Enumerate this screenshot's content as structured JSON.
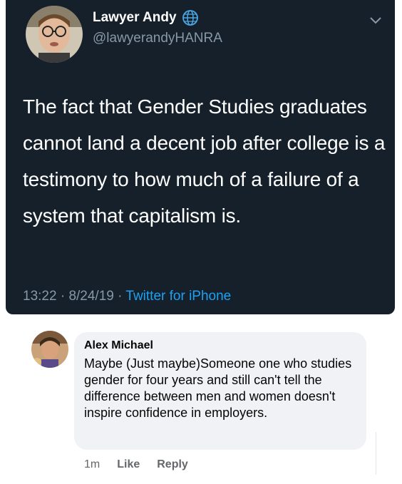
{
  "tweet": {
    "author_name": "Lawyer Andy",
    "handle": "@lawyerandyHANRA",
    "text": "The fact that Gender Studies graduates cannot land a decent job after college is a testimony to how much of a failure of a system that capitalism is.",
    "time": "13:22",
    "date": "8/24/19",
    "source": "Twitter for iPhone",
    "sep": "·",
    "colors": {
      "background": "#15202b",
      "secondary_text": "#8899a6",
      "link": "#1da1f2"
    }
  },
  "comment": {
    "author_name": "Alex Michael",
    "text": "Maybe (Just maybe)Someone one who studies gender for four years and still can't tell the difference between men and women doesn't inspire confidence in employers.",
    "time": "1m",
    "like_label": "Like",
    "reply_label": "Reply",
    "colors": {
      "bubble": "#f0f2f5",
      "muted": "#65676b"
    }
  }
}
